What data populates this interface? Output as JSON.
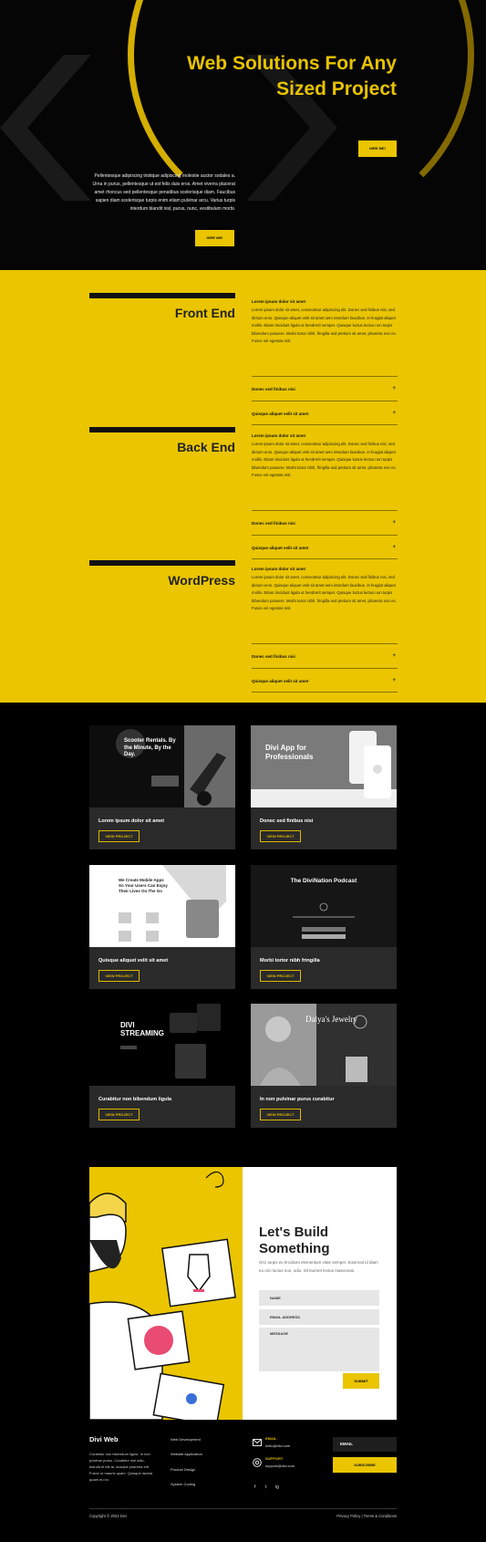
{
  "hero": {
    "title": "Web Solutions For Any Sized Project",
    "button_top": "HIRE ME!",
    "copy": "Pellentesque adipiscing tristique adipiscing molestie auctor sodales a. Urna in purus, pellentesque ut est felis duis eros. Amet viverra placerat amet rhoncus sed pellentesque penatibus scelerisque diam. Faucibus sapien diam scelerisque turpis enim etiam pulvinar arcu. Varius turpis interdum blandit nisl, purus, nunc, vestibulum morbi.",
    "button_bottom": "HIRE ME!"
  },
  "services": [
    {
      "title": "Front End",
      "heading": "Lorem ipsum dolor sit amet",
      "body": "Lorem ipsum dolor sit amet, consectetur adipiscing elit. Donec sed finibus nisi, sed dictum eros. Quisque aliquet velit sit amet sem interdum faucibus. In feugiat aliquet mollis. Etiam tincidunt ligula ut hendrerit semper. Quisque luctus lectus non turpis bibendum posuere. Morbi tortor nibh, fringilla sed pretium sit amet, pharetra non ex. Fusce vel egestas nisl.",
      "acc1": "Donec sed finibus nisi",
      "acc2": "Quisque aliquet velit sit amet"
    },
    {
      "title": "Back End",
      "heading": "Lorem ipsum dolor sit amet",
      "body": "Lorem ipsum dolor sit amet, consectetur adipiscing elit. Donec sed finibus nisi, sed dictum eros. Quisque aliquet velit sit amet sem interdum faucibus. In feugiat aliquet mollis. Etiam tincidunt ligula ut hendrerit semper. Quisque luctus lectus non turpis bibendum posuere. Morbi tortor nibh, fringilla sed pretium sit amet, pharetra non ex. Fusce vel egestas nisl.",
      "acc1": "Donec sed finibus nisi",
      "acc2": "Quisque aliquet velit sit amet"
    },
    {
      "title": "WordPress",
      "heading": "Lorem ipsum dolor sit amet",
      "body": "Lorem ipsum dolor sit amet, consectetur adipiscing elit. Donec sed finibus nisi, sed dictum eros. Quisque aliquet velit sit amet sem interdum faucibus. In feugiat aliquet mollis. Etiam tincidunt ligula ut hendrerit semper. Quisque luctus lectus non turpis bibendum posuere. Morbi tortor nibh, fringilla sed pretium sit amet, pharetra non ex. Fusce vel egestas nisl.",
      "acc1": "Donec sed finibus nisi",
      "acc2": "Quisque aliquet velit sit amet"
    }
  ],
  "accordion_icon": "+",
  "projects": [
    {
      "title": "Lorem ipsum dolor sit amet",
      "button": "VIEW PROJECT",
      "thumb_heading": "Scooter Rentals. By the Minute, By the Day."
    },
    {
      "title": "Donec sed finibus nisi",
      "button": "VIEW PROJECT",
      "thumb_heading": "Divi App for Professionals"
    },
    {
      "title": "Quisque aliquet velit sit amet",
      "button": "VIEW PROJECT",
      "thumb_heading": "We Create Mobile Apps So Your Users Can Enjoy Their Lives On The Go"
    },
    {
      "title": "Morbi tortor nibh fringilla",
      "button": "VIEW PROJECT",
      "thumb_heading": "The DiviNation Podcast"
    },
    {
      "title": "Curabitur non bibendum ligula",
      "button": "VIEW PROJECT",
      "thumb_heading": "DIVI STREAMING"
    },
    {
      "title": "In non pulvinar purus curabitur",
      "button": "VIEW PROJECT",
      "thumb_heading": "Dalya's Jewelry"
    }
  ],
  "contact": {
    "title": "Let's Build Something",
    "text": "Orci turpis eu tincidunt elementum vitae semper. Euismod id diam eu orci luctus non, odio. Sit laoreet lectus maecenas.",
    "name_field": "NAME",
    "email_field": "EMAIL ADDRESS",
    "message_field": "MESSAGE",
    "submit": "SUBMIT"
  },
  "footer": {
    "brand": "Divi Web",
    "about": "Curabitur non bibendum ligula. In non pulvinar purus. Curabitur nisi odio, blandit et elit at, suscipit pharetra elit. Fusce ut mauris quam. Quisque lacinia quam eu ex.",
    "links": [
      "Web Development",
      "Website Application",
      "Product Design",
      "System Coding"
    ],
    "email_label": "EMAIL",
    "email_value": "hello@divi.com",
    "support_label": "SUPPORT",
    "support_value": "support@divi.com",
    "social": [
      "f",
      "t",
      "ig"
    ],
    "newsletter_placeholder": "EMAIL",
    "subscribe": "SUBSCRIBE",
    "copyright": "Copyright © 2022 Divi",
    "legal": "Privacy Policy | Terms & Conditions"
  },
  "colors": {
    "accent": "#eac500",
    "dark": "#050505",
    "card": "#2a2a2a"
  }
}
